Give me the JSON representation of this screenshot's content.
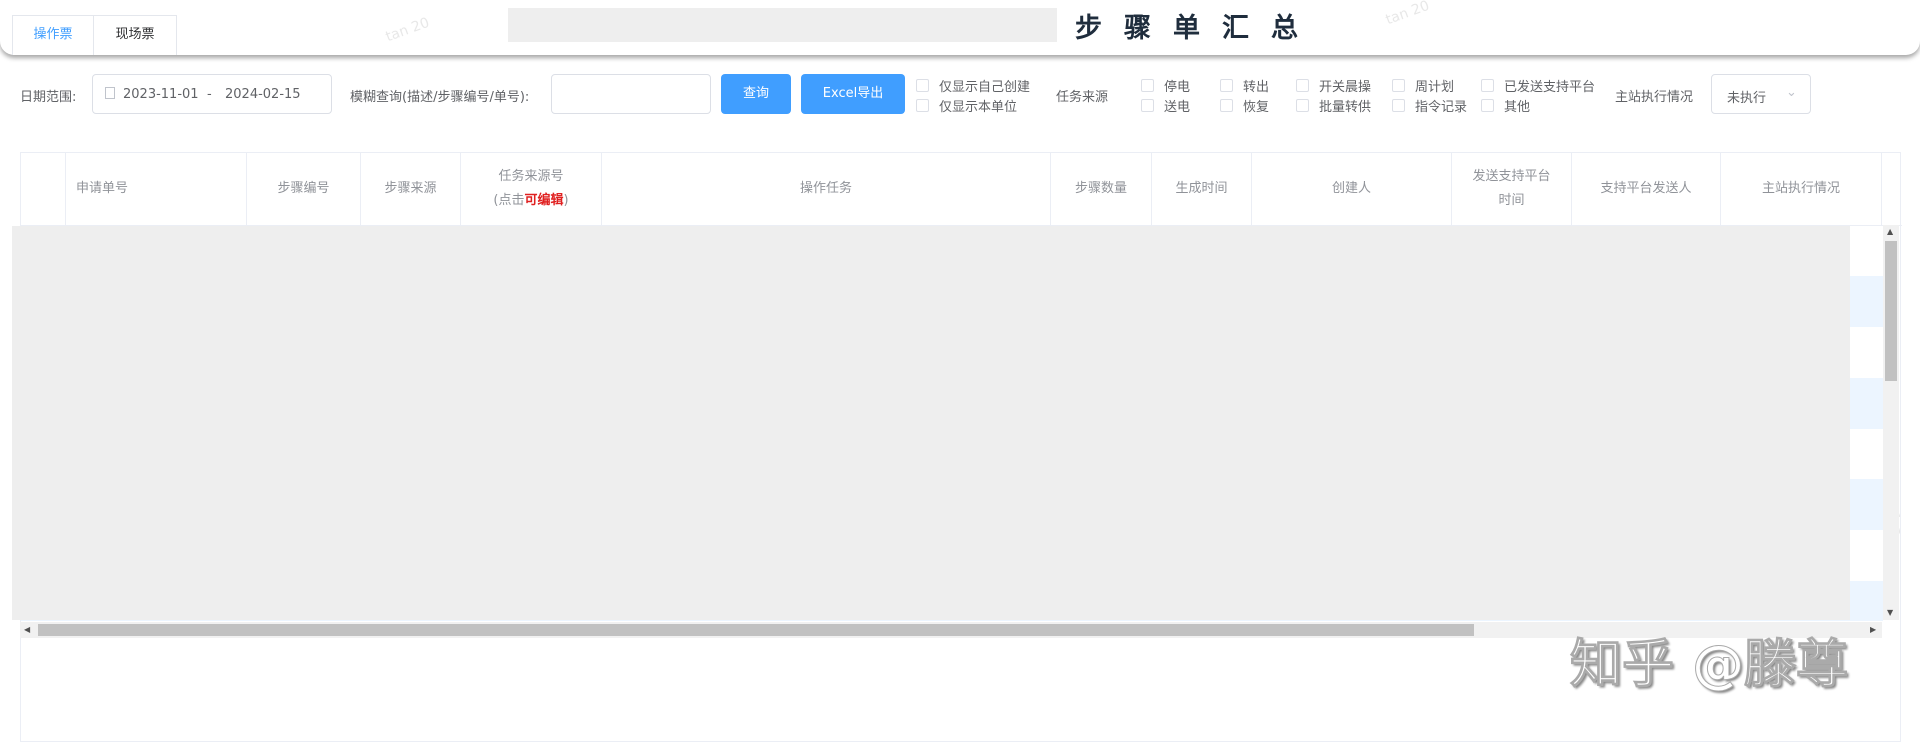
{
  "tabs": [
    {
      "label": "操作票",
      "active": true
    },
    {
      "label": "现场票",
      "active": false
    }
  ],
  "page_title": "步骤单汇总",
  "filters": {
    "date_label": "日期范围:",
    "date_start": "2023-11-01",
    "date_sep": "-",
    "date_end": "2024-02-15",
    "fuzzy_label": "模糊查询(描述/步骤编号/单号):",
    "fuzzy_value": "",
    "query_button": "查询",
    "export_button": "Excel导出",
    "own_created": "仅显示自己创建",
    "own_unit": "仅显示本单位",
    "source_label": "任务来源",
    "sources": [
      "停电",
      "送电",
      "转出",
      "恢复",
      "开关晨操",
      "批量转供",
      "周计划",
      "指令记录",
      "已发送支持平台",
      "其他"
    ],
    "exec_label": "主站执行情况",
    "exec_value": "未执行"
  },
  "table": {
    "headers": [
      "",
      "申请单号",
      "步骤编号",
      "步骤来源",
      "任务来源号",
      "操作任务",
      "步骤数量",
      "生成时间",
      "创建人",
      "发送支持平台时间",
      "支持平台发送人",
      "主站执行情况",
      ""
    ],
    "source_sub_prefix": "(点击",
    "source_sub_em": "可编辑",
    "source_sub_suffix": ")",
    "send_time_l1": "发送支持平台",
    "send_time_l2": "时间"
  },
  "watermark": "知乎 @滕尊",
  "bg_watermark": "tan 20",
  "colors": {
    "primary": "#409eff",
    "title": "#1f2d3d",
    "edit": "#e02020"
  }
}
